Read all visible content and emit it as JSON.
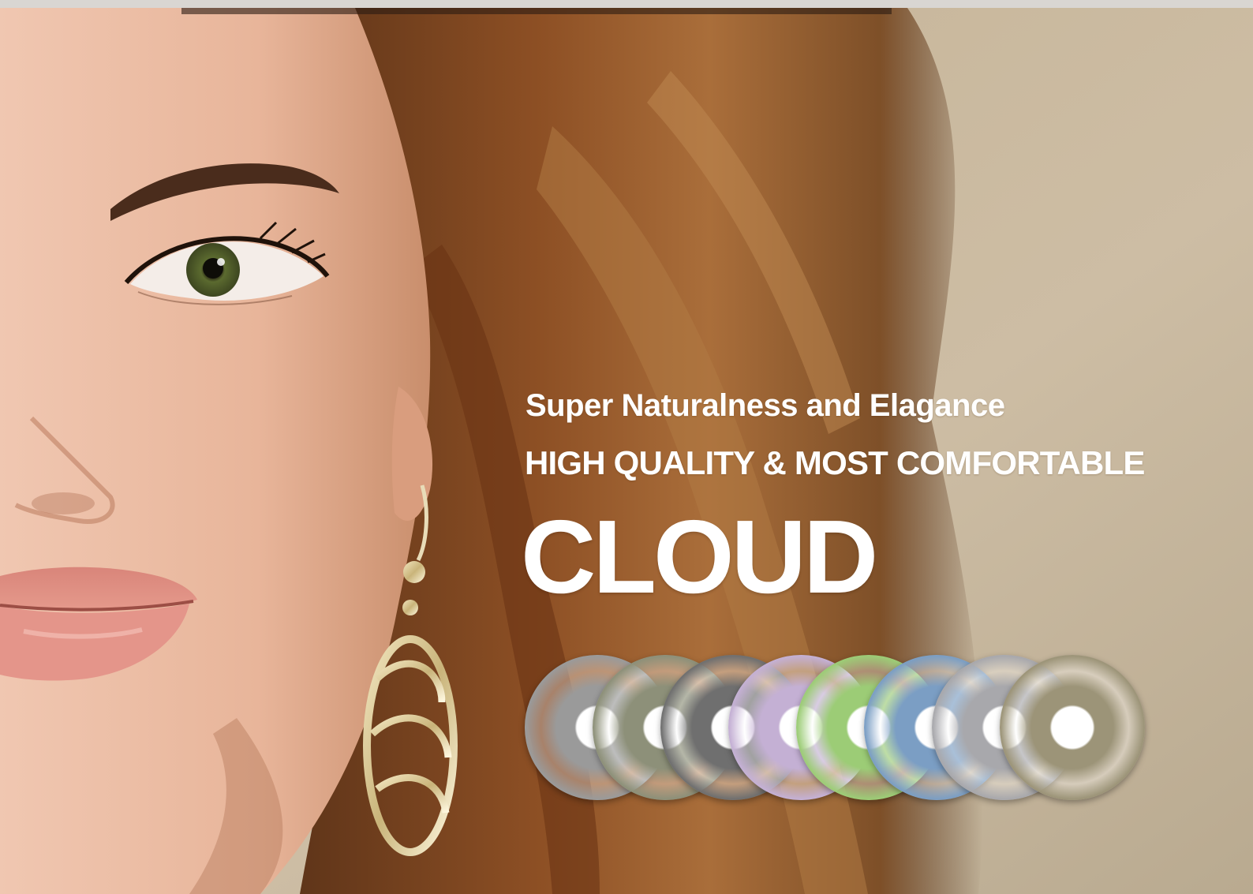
{
  "banner": {
    "tagline": "Super Naturalness and Elagance",
    "subtitle": "HIGH QUALITY & MOST COMFORTABLE",
    "brand": "CLOUD"
  },
  "lenses": [
    {
      "color_name": "gray",
      "color": "#9a9a9a"
    },
    {
      "color_name": "olive-gray",
      "color": "#8d9079"
    },
    {
      "color_name": "dark-gray",
      "color": "#6f6f6f"
    },
    {
      "color_name": "lavender",
      "color": "#c4b0d4"
    },
    {
      "color_name": "green",
      "color": "#9ccc76"
    },
    {
      "color_name": "blue",
      "color": "#7b9ec4"
    },
    {
      "color_name": "silver",
      "color": "#a8a8ac"
    },
    {
      "color_name": "hazel",
      "color": "#9c9478"
    }
  ],
  "colors": {
    "backdrop": "#c9b99f",
    "hair": "#7a4520",
    "skin": "#e6b49a",
    "text": "#ffffff"
  }
}
